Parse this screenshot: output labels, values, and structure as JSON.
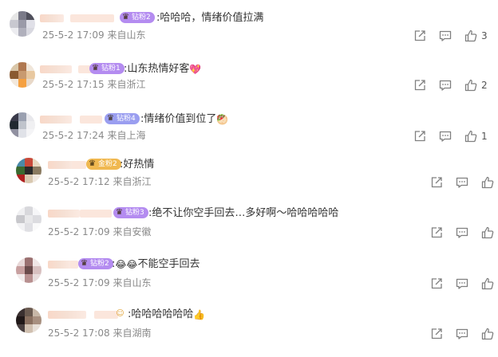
{
  "comments": [
    {
      "badge": "钻粉2",
      "badge_color": "#b48cf0",
      "text": ":哈哈哈，情绪价值拉满",
      "emoji": "",
      "date": "25-5-2 17:09",
      "location": "来自山东",
      "likes": "3",
      "avatar_colors": [
        "#e6e6e6",
        "#7a7a88",
        "#50505c",
        "#c8c8d0",
        "#9a9aa8",
        "#e0e0e8",
        "#ececf0",
        "#b0b0bc",
        "#d8d8e0"
      ]
    },
    {
      "badge": "钻粉1",
      "badge_color": "#b48cf0",
      "text": ":山东热情好客",
      "emoji": "💖",
      "date": "25-5-2 17:15",
      "location": "来自浙江",
      "likes": "2",
      "avatar_colors": [
        "#d9c6a8",
        "#b07850",
        "#f0e6da",
        "#8a5a30",
        "#c89a70",
        "#e8c8a0",
        "#f2e8dc",
        "#f5a040",
        "#e8d8c8"
      ]
    },
    {
      "badge": "钻粉4",
      "badge_color": "#9a9ef0",
      "text": ":情绪价值到位了",
      "emoji": "🥙",
      "date": "25-5-2 17:24",
      "location": "来自上海",
      "likes": "1",
      "avatar_colors": [
        "#3a3a4a",
        "#9aa0b0",
        "#e8e8ec",
        "#202830",
        "#c0c4cc",
        "#f0f0f2",
        "#9090a0",
        "#e0e2e8",
        "#f4f4f6"
      ]
    },
    {
      "badge": "金粉2",
      "badge_color": "#f0b850",
      "text": ":好热情",
      "emoji": "",
      "date": "25-5-2 17:12",
      "location": "来自浙江",
      "likes": "",
      "avatar_colors": [
        "#4a8aa8",
        "#c84a3a",
        "#e8d8c0",
        "#3a6a30",
        "#2a2a2a",
        "#8a7a60",
        "#b02020",
        "#d8c8b0",
        "#f0e8e0"
      ]
    },
    {
      "badge": "钻粉3",
      "badge_color": "#b48cf0",
      "text": ":绝不让你空手回去…多好啊～哈哈哈哈哈",
      "emoji": "",
      "date": "25-5-2 17:09",
      "location": "来自安徽",
      "likes": "",
      "avatar_colors": [
        "#f0f0f2",
        "#d8d8dc",
        "#f6f6f8",
        "#c8c8cc",
        "#e8e8ea",
        "#dcdce0",
        "#f2f2f4",
        "#e0e0e4",
        "#fafafa"
      ]
    },
    {
      "badge": "钻粉2",
      "badge_color": "#b48cf0",
      "text": ":",
      "emoji": "😂😂",
      "text_after": "不能空手回去",
      "date": "25-5-2 17:09",
      "location": "来自山东",
      "likes": "",
      "avatar_colors": [
        "#e8d8d8",
        "#9a7070",
        "#f0e6e6",
        "#c8a0a0",
        "#6a4a4a",
        "#d8c0c0",
        "#f2eaea",
        "#b89090",
        "#e8dcdc"
      ]
    },
    {
      "badge": "",
      "badge_color": "#f0b850",
      "text": ":哈哈哈哈哈哈",
      "emoji": "👍",
      "date": "25-5-2 17:08",
      "location": "来自湖南",
      "likes": "",
      "avatar_colors": [
        "#3a3030",
        "#6a5a50",
        "#c8b8a8",
        "#201818",
        "#8a7060",
        "#a89080",
        "#4a4040",
        "#d0c0b0",
        "#e8e0d8"
      ]
    }
  ],
  "icons": {
    "share": "share-icon",
    "comment": "comment-icon",
    "like": "thumbs-up-icon"
  }
}
